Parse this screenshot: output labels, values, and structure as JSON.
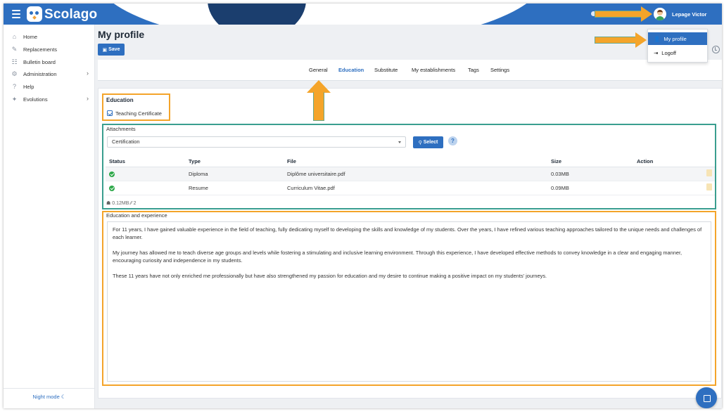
{
  "app": {
    "brand": "Scolago",
    "user_name": "Lepage Victor"
  },
  "sidebar": {
    "items": [
      {
        "label": "Home",
        "icon": "home-icon"
      },
      {
        "label": "Replacements",
        "icon": "replacements-icon"
      },
      {
        "label": "Bulletin board",
        "icon": "bulletin-icon"
      },
      {
        "label": "Administration",
        "icon": "gear-icon",
        "has_children": true
      },
      {
        "label": "Help",
        "icon": "help-icon"
      },
      {
        "label": "Evolutions",
        "icon": "evolutions-icon",
        "has_children": true
      }
    ],
    "night_mode": "Night mode"
  },
  "page": {
    "title": "My profile",
    "save_label": "Save"
  },
  "tabs": [
    {
      "label": "General",
      "active": false
    },
    {
      "label": "Education",
      "active": true
    },
    {
      "label": "Substitute",
      "active": false
    },
    {
      "label": "My establishments",
      "active": false
    },
    {
      "label": "Tags",
      "active": false
    },
    {
      "label": "Settings",
      "active": false
    }
  ],
  "dropdown": {
    "my_profile": "My profile",
    "logoff": "Logoff"
  },
  "education": {
    "title": "Education",
    "teaching_certificate_label": "Teaching Certificate",
    "teaching_certificate_checked": true
  },
  "attachments": {
    "label": "Attachments",
    "select_value": "Certification",
    "select_button": "Select",
    "help": "?",
    "columns": [
      "Status",
      "Type",
      "File",
      "Size",
      "Action"
    ],
    "rows": [
      {
        "type": "Diploma",
        "file": "Diplôme universitaire.pdf",
        "size": "0.03MB"
      },
      {
        "type": "Resume",
        "file": "Curriculum Vitae.pdf",
        "size": "0.09MB"
      }
    ],
    "summary_size": "0.12MB",
    "summary_count": "2"
  },
  "experience": {
    "label": "Education and experience",
    "paragraphs": [
      "For 11 years, I have gained valuable experience in the field of teaching, fully dedicating myself to developing the skills and knowledge of my students. Over the years, I have refined various teaching approaches tailored to the unique needs and challenges of each learner.",
      "My journey has allowed me to teach diverse age groups and levels while fostering a stimulating and inclusive learning environment. Through this experience, I have developed effective methods to convey knowledge in a clear and engaging manner, encouraging curiosity and independence in my students.",
      "These 11 years have not only enriched me professionally but have also strengthened my passion for education and my desire to continue making a positive impact on my students' journeys."
    ]
  },
  "colors": {
    "primary": "#2e6fc0",
    "annotation_orange": "#f4a42a",
    "annotation_teal": "#3a9e8f",
    "success": "#2ea84a"
  }
}
